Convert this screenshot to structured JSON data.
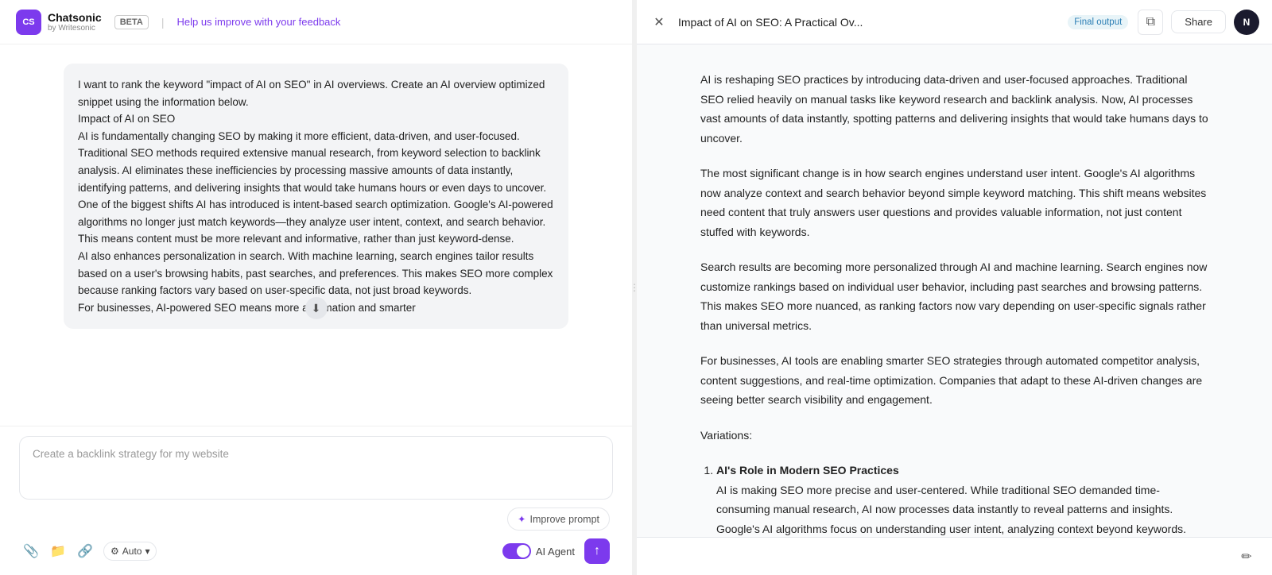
{
  "left": {
    "logo": {
      "initials": "CS",
      "app_name": "Chatsonic",
      "sub_name": "by Writesonic"
    },
    "beta_label": "BETA",
    "feedback_link": "Help us improve with your feedback",
    "message": {
      "text": "I want to rank the keyword \"impact of AI on SEO\" in AI overviews. Create an AI overview optimized snippet using the information below.\nImpact of AI on SEO\nAI is fundamentally changing SEO by making it more efficient, data-driven, and user-focused. Traditional SEO methods required extensive manual research, from keyword selection to backlink analysis. AI eliminates these inefficiencies by processing massive amounts of data instantly, identifying patterns, and delivering insights that would take humans hours or even days to uncover.\nOne of the biggest shifts AI has introduced is intent-based search optimization. Google's AI-powered algorithms no longer just match keywords—they analyze user intent, context, and search behavior. This means content must be more relevant and informative, rather than just keyword-dense.\nAI also enhances personalization in search. With machine learning, search engines tailor results based on a user's browsing habits, past searches, and preferences. This makes SEO more complex because ranking factors vary based on user-specific data, not just broad keywords.\nFor businesses, AI-powered SEO means more automation and smarter"
    },
    "input_placeholder": "Create a backlink strategy for my website",
    "improve_prompt_label": "Improve prompt",
    "auto_label": "Auto",
    "ai_agent_label": "AI Agent"
  },
  "right": {
    "close_icon": "×",
    "doc_title": "Impact of AI on SEO: A Practical Ov...",
    "final_output_label": "Final output",
    "copy_icon": "⧉",
    "share_label": "Share",
    "user_initials": "N",
    "content": {
      "paragraphs": [
        "AI is reshaping SEO practices by introducing data-driven and user-focused approaches. Traditional SEO relied heavily on manual tasks like keyword research and backlink analysis. Now, AI processes vast amounts of data instantly, spotting patterns and delivering insights that would take humans days to uncover.",
        "The most significant change is in how search engines understand user intent. Google's AI algorithms now analyze context and search behavior beyond simple keyword matching. This shift means websites need content that truly answers user questions and provides valuable information, not just content stuffed with keywords.",
        "Search results are becoming more personalized through AI and machine learning. Search engines now customize rankings based on individual user behavior, including past searches and browsing patterns. This makes SEO more nuanced, as ranking factors now vary depending on user-specific signals rather than universal metrics.",
        "For businesses, AI tools are enabling smarter SEO strategies through automated competitor analysis, content suggestions, and real-time optimization. Companies that adapt to these AI-driven changes are seeing better search visibility and engagement."
      ],
      "variations_label": "Variations:",
      "variations": [
        {
          "title": "AI's Role in Modern SEO Practices",
          "text": "AI is making SEO more precise and user-centered. While traditional SEO demanded time-consuming manual research, AI now processes data instantly to reveal patterns and insights. Google's AI algorithms focus on understanding user intent, analyzing context beyond keywords. This means websites must create genuinely helpful content that addresses user needs. With AI-powered"
        }
      ]
    },
    "edit_icon": "✏"
  }
}
